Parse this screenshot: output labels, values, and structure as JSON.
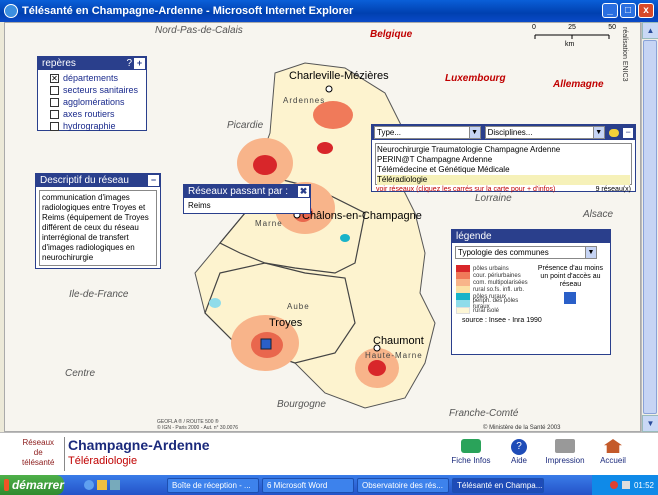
{
  "window": {
    "title": "Télésanté en Champagne-Ardenne - Microsoft Internet Explorer",
    "buttons": [
      "_",
      "□",
      "x"
    ]
  },
  "map": {
    "regions_outside": [
      "Nord-Pas-de-Calais",
      "Belgique",
      "Luxembourg",
      "Allemagne",
      "Picardie",
      "Lorraine",
      "Alsace",
      "Ile-de-France",
      "Centre",
      "Bourgogne",
      "Franche-Comté"
    ],
    "departments": [
      "Ardennes",
      "Marne",
      "Aube",
      "Haute-Marne"
    ],
    "cities": [
      "Charleville-Mézières",
      "Châlons-en-Champagne",
      "Troyes",
      "Chaumont"
    ],
    "scale": {
      "ticks": [
        "0",
        "25",
        "50"
      ],
      "unit": "km"
    },
    "realisation": "réalisation ENIC3",
    "credits": [
      "GEOFLA ® / ROUTE 500 ®",
      "© IGN - Paris 2000 - Aut. n° 30.0076"
    ],
    "copyright": "© Ministère de la Santé 2003"
  },
  "reperes": {
    "title": "repères",
    "help": "?",
    "items": [
      {
        "label": "départements",
        "checked": true
      },
      {
        "label": "secteurs sanitaires",
        "checked": false
      },
      {
        "label": "agglomérations",
        "checked": false
      },
      {
        "label": "axes routiers",
        "checked": false
      },
      {
        "label": "hydrographie",
        "checked": false
      }
    ]
  },
  "descriptif": {
    "title": "Descriptif du réseau",
    "text": "communication d'images radiologiques entre Troyes et Reims (équipement de Troyes différent de ceux du réseau interrégional de transfert d'images radiologiques en neurochirurgie"
  },
  "reseaux_passant": {
    "title": "Réseaux passant par :",
    "value": "Reims",
    "close": "✖"
  },
  "filter": {
    "type_label": "Type...",
    "disciplines_label": "Disciplines...",
    "items": [
      "Neurochirurgie Traumatologie Champagne Ardenne",
      "PERIN@T Champagne Ardenne",
      "Télémédecine  et Génétique Médicale",
      "Téléradiologie"
    ],
    "selected_index": 3,
    "hint": "voir réseaux (cliquez les carrés sur la carte pour + d'infos)",
    "count": "9 réseau(x)"
  },
  "legende": {
    "title": "légende",
    "select": "Typologie des communes",
    "rows": [
      {
        "label": "pôles urbains",
        "color": "#d8262a"
      },
      {
        "label": "cour. périurbaines",
        "color": "#f07a5a"
      },
      {
        "label": "com. multipolarisées",
        "color": "#f8b48a"
      },
      {
        "label": "rural so.fs. infl. urb.",
        "color": "#fbe1a6"
      },
      {
        "label": "pôles ruraux",
        "color": "#19b3c9"
      },
      {
        "label": "périph. des pôles ruraux",
        "color": "#8fdcea"
      },
      {
        "label": "rural isolé",
        "color": "#fdf6d5"
      }
    ],
    "presence": "Présence d'au moins un point d'accès au réseau",
    "presence_color": "#2a5fc8",
    "source": "source : Insee - Inra 1990"
  },
  "footer": {
    "brand_lines": [
      "Réseaux",
      "de",
      "télésanté"
    ],
    "region": "Champagne-Ardenne",
    "subtitle": "Téléradiologie",
    "buttons": [
      "Fiche Infos",
      "Aide",
      "Impression",
      "Accueil"
    ]
  },
  "taskbar": {
    "start": "démarrer",
    "tasks": [
      "Boîte de réception - ...",
      "6 Microsoft Word",
      "Observatoire des rés...",
      "Télésanté en Champa..."
    ],
    "time": "01:52"
  }
}
